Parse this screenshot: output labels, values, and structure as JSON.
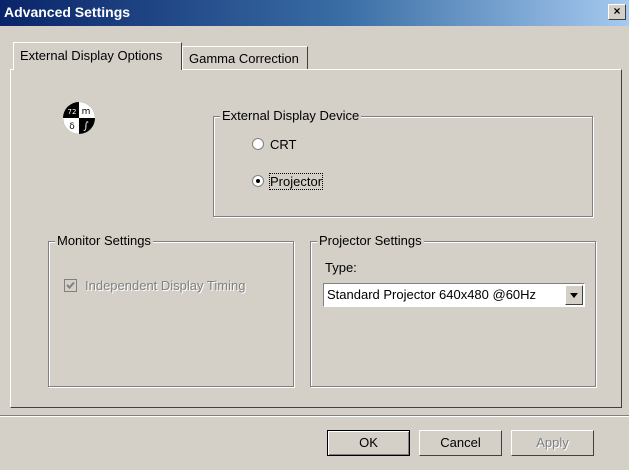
{
  "window": {
    "title": "Advanced Settings",
    "close_glyph": "×"
  },
  "tabs": [
    {
      "label": "External Display Options"
    },
    {
      "label": "Gamma Correction"
    }
  ],
  "logo": {
    "glyphs": [
      "72",
      "m",
      "δ",
      "∫"
    ]
  },
  "external_display": {
    "legend": "External Display Device",
    "options": [
      {
        "label": "CRT",
        "checked": false
      },
      {
        "label": "Projector",
        "checked": true
      }
    ]
  },
  "monitor_settings": {
    "legend": "Monitor Settings",
    "independent_timing_label": "Independent Display Timing"
  },
  "projector_settings": {
    "legend": "Projector Settings",
    "type_label": "Type:",
    "type_value": "Standard Projector 640x480 @60Hz"
  },
  "buttons": {
    "ok": "OK",
    "cancel": "Cancel",
    "apply": "Apply"
  }
}
